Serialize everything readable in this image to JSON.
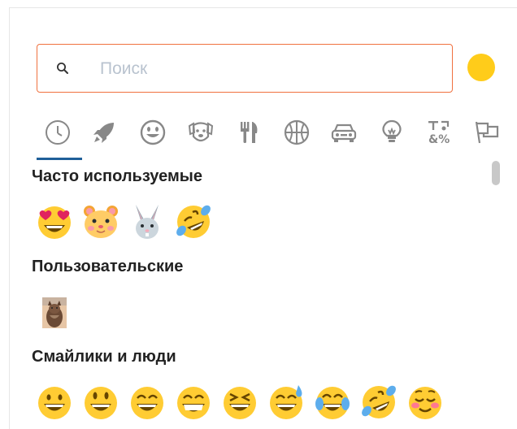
{
  "search": {
    "placeholder": "Поиск",
    "value": "",
    "border_color": "#f0713f"
  },
  "skin_tone": {
    "color": "#ffcc1a"
  },
  "category_tabs": [
    {
      "icon": "clock-icon",
      "label": "recent"
    },
    {
      "icon": "rocket-icon",
      "label": "travel"
    },
    {
      "icon": "smiley-icon",
      "label": "people"
    },
    {
      "icon": "dog-icon",
      "label": "nature"
    },
    {
      "icon": "fork-knife-icon",
      "label": "food"
    },
    {
      "icon": "basketball-icon",
      "label": "activity"
    },
    {
      "icon": "car-icon",
      "label": "places"
    },
    {
      "icon": "lightbulb-icon",
      "label": "objects"
    },
    {
      "icon": "symbols-icon",
      "label": "symbols"
    },
    {
      "icon": "flags-icon",
      "label": "flags"
    }
  ],
  "active_tab_color": "#1f5f99",
  "sections": {
    "frequent": {
      "title": "Часто используемые",
      "emojis": [
        "heart-eyes-smile-emoji",
        "hamster-face-emoji",
        "rabbit-face-emoji",
        "rofl-emoji"
      ]
    },
    "custom": {
      "title": "Пользовательские",
      "emojis": [
        "custom-cat-photo-emoji"
      ]
    },
    "smileys": {
      "title": "Смайлики и люди",
      "emojis": [
        "grinning-emoji",
        "smiley-emoji",
        "smile-emoji",
        "grin-emoji",
        "laughing-emoji",
        "sweat-smile-emoji",
        "joy-emoji",
        "rofl-emoji",
        "relaxed-emoji"
      ]
    }
  }
}
